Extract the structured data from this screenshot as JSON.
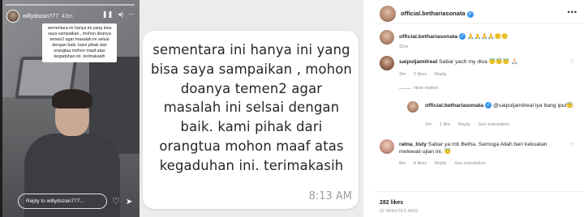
{
  "story": {
    "username": "willydozan777",
    "time": "43m",
    "overlay_text": "sementara ini hanya ini yang bisa saya sampaikan , mohon doanya temen2 agar masalah ini selsai dengan baik. kami pihak dari orangtua mohon maaf atas kegaduhan ini. terimakasih",
    "reply_placeholder": "Reply to willydozan777...",
    "icons": [
      "pause-icon",
      "mute-icon",
      "more-icon",
      "heart-icon",
      "send-icon"
    ]
  },
  "chat_bubble": {
    "message": "sementara ini hanya ini yang bisa saya sampaikan , mohon doanya temen2 agar masalah ini selsai dengan baik. kami pihak dari orangtua mohon maaf atas kegaduhan ini. terimakasih",
    "time": "8:13 AM"
  },
  "instagram": {
    "post_author": "official.bethariasonata",
    "caption_author": "official.bethariasonata",
    "caption_text": "🙏🙏🙏🙏🙂🙂",
    "caption_time": "32m",
    "comments": [
      {
        "author": "saipuljamilreal",
        "text": "Sabar yach my diva 😇😇😇 🙏🏻",
        "time": "3m",
        "likes": "2 likes",
        "reply": "Reply",
        "hide_replies": "Hide replies"
      },
      {
        "author": "official.bethariasonata",
        "text": "@saipuljamilreal iya bang ipul😇",
        "time": "2m",
        "likes": "1 like",
        "reply": "Reply",
        "translation": "See translation"
      },
      {
        "author": "ratna_listy",
        "text": "Sabar ya mb Betha. Semoga Allah beri kekuatan melewati ujian ini. 😇",
        "time": "8m",
        "likes": "6 likes",
        "reply": "Reply",
        "translation": "See translation"
      }
    ],
    "likes_total": "282 likes",
    "posted_ago": "32 MINUTES AGO"
  },
  "colors": {
    "verified": "#3897f0",
    "meta_text": "#8e8e8e",
    "bubble_bg": "#ececec"
  }
}
